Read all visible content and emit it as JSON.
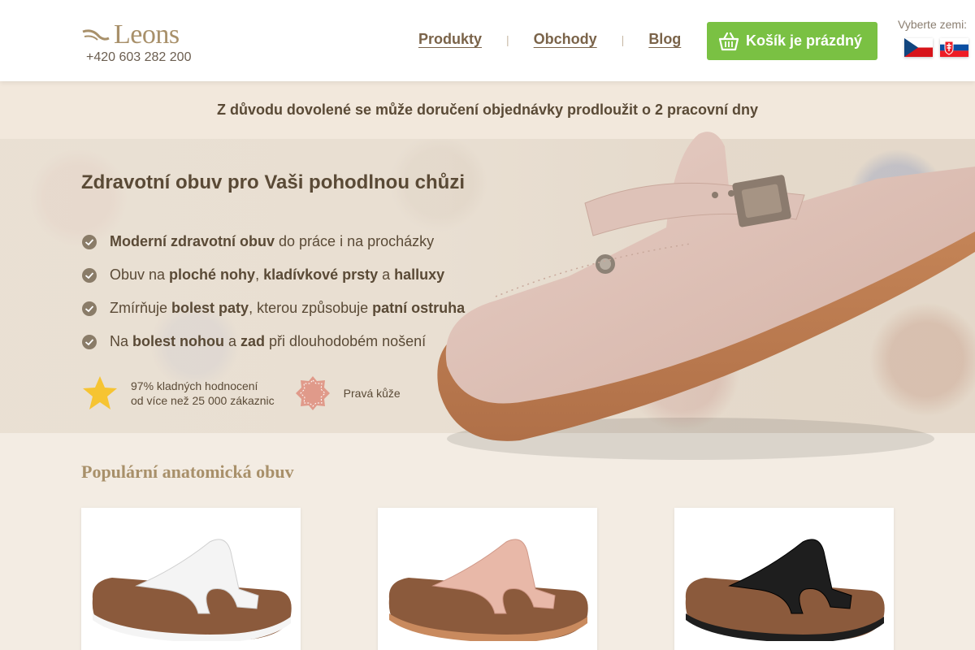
{
  "header": {
    "logo_text": "Leons",
    "phone": "+420 603 282 200",
    "nav": [
      {
        "label": "Produkty"
      },
      {
        "label": "Obchody"
      },
      {
        "label": "Blog"
      }
    ],
    "cart_label": "Košík je prázdný",
    "country_label": "Vyberte zemi:",
    "flags": [
      "cz-flag-icon",
      "sk-flag-icon"
    ]
  },
  "notice": "Z důvodu dovolené se může doručení objednávky prodloužit o 2 pracovní dny",
  "hero": {
    "title": "Zdravotní obuv pro Vaši pohodlnou chůzi",
    "benefits": [
      {
        "b1": "Moderní zdravotní obuv",
        "t1": " do práce i na procházky"
      },
      {
        "t0": "Obuv na ",
        "b1": "ploché nohy",
        "t1": ", ",
        "b2": "kladívkové prsty",
        "t2": " a ",
        "b3": "halluxy"
      },
      {
        "t0": "Zmírňuje ",
        "b1": "bolest paty",
        "t1": ", kterou způsobuje ",
        "b2": "patní ostruha"
      },
      {
        "t0": "Na ",
        "b1": "bolest nohou",
        "t1": " a ",
        "b2": "zad",
        "t2": " při dlouhodobém nošení"
      }
    ],
    "badges": [
      {
        "icon": "star-icon",
        "line1": "97% kladných hodnocení",
        "line2": "od více než 25 000 zákaznic"
      },
      {
        "icon": "leather-icon",
        "line1": "Pravá kůže"
      }
    ]
  },
  "popular": {
    "title": "Populární anatomická obuv",
    "products": [
      {
        "color": "#f4f4f4",
        "name": "white-sandal"
      },
      {
        "color": "#e8b8a8",
        "name": "pink-sandal"
      },
      {
        "color": "#1e1e1e",
        "name": "black-sandal"
      }
    ]
  },
  "colors": {
    "accent_green": "#7ac143",
    "brand_gold": "#a8906a",
    "text_brown": "#5a4a36"
  }
}
